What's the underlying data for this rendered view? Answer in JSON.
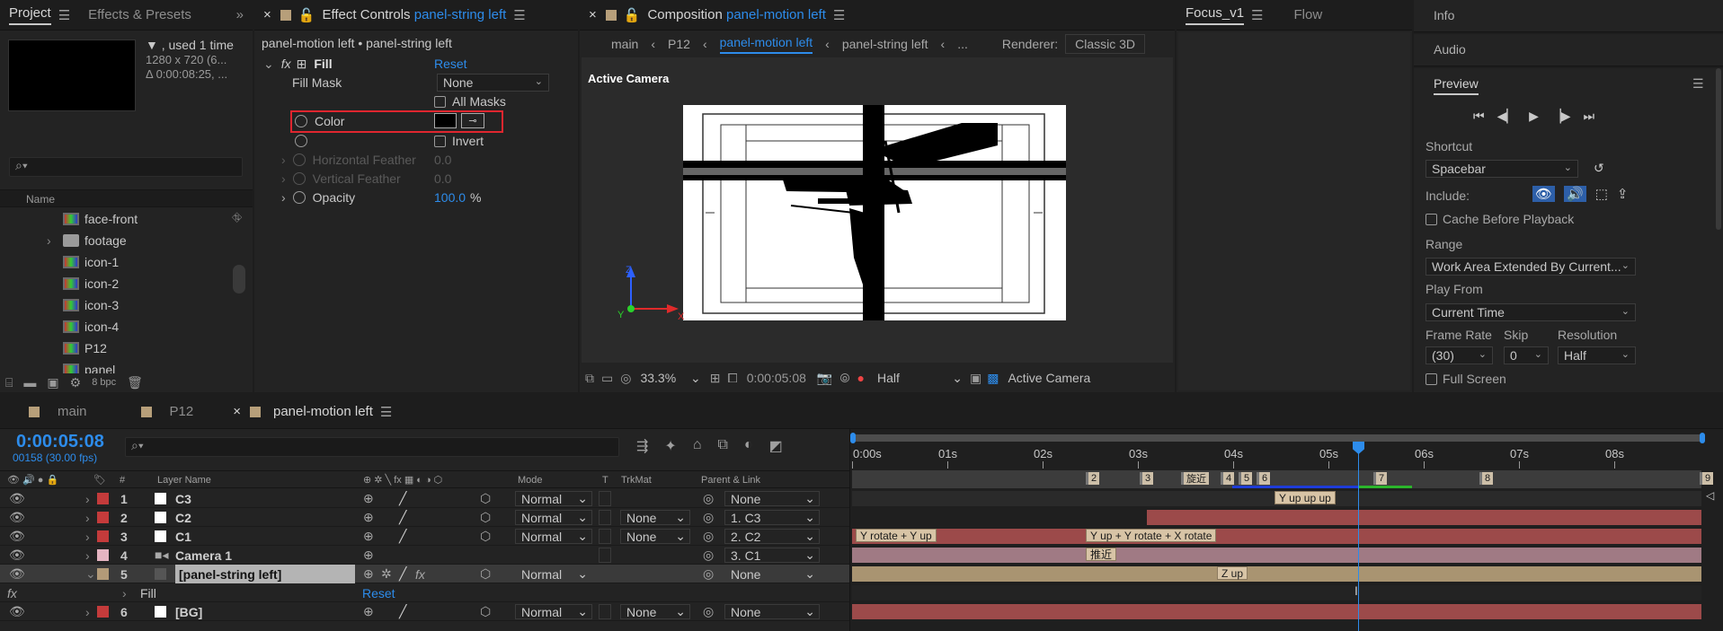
{
  "project": {
    "tab_project": "Project",
    "tab_effects": "Effects & Presets",
    "overflow": "»",
    "used": "▼ , used 1 time",
    "dims": "1280 x 720  (6...",
    "duration": "Δ 0:00:08:25, ...",
    "search_placeholder": "",
    "col_name": "Name",
    "items": [
      "face-front",
      "footage",
      "icon-1",
      "icon-2",
      "icon-3",
      "icon-4",
      "P12",
      "panel"
    ],
    "bpc": "8 bpc"
  },
  "effect_controls": {
    "title": "Effect Controls",
    "layer": "panel-string left",
    "breadcrumb": "panel-motion left • panel-string left",
    "fx_label": "fx",
    "effect_name": "Fill",
    "reset": "Reset",
    "fill_mask_label": "Fill Mask",
    "fill_mask_value": "None",
    "all_masks": "All Masks",
    "color_label": "Color",
    "invert": "Invert",
    "h_feather": "Horizontal Feather",
    "h_feather_val": "0.0",
    "v_feather": "Vertical Feather",
    "v_feather_val": "0.0",
    "opacity": "Opacity",
    "opacity_val": "100.0",
    "opacity_unit": "%"
  },
  "composition": {
    "title": "Composition",
    "name": "panel-motion left",
    "crumbs": [
      "main",
      "P12",
      "panel-motion left",
      "panel-string left",
      "..."
    ],
    "renderer_label": "Renderer:",
    "renderer_value": "Classic 3D",
    "active_camera_label": "Active Camera",
    "zoom": "33.3%",
    "timecode": "0:00:05:08",
    "resolution": "Half",
    "view": "Active Camera",
    "axis_z": "Z",
    "axis_y": "Y",
    "axis_x": "X"
  },
  "focus": {
    "tab1": "Focus_v1",
    "tab2": "Flow"
  },
  "right": {
    "info": "Info",
    "audio": "Audio",
    "preview": "Preview",
    "shortcut_label": "Shortcut",
    "shortcut_value": "Spacebar",
    "include_label": "Include:",
    "cache": "Cache Before Playback",
    "range_label": "Range",
    "range_value": "Work Area Extended By Current...",
    "playfrom_label": "Play From",
    "playfrom_value": "Current Time",
    "fr_label": "Frame Rate",
    "skip_label": "Skip",
    "res_label": "Resolution",
    "fr_value": "(30)",
    "skip_value": "0",
    "res_value": "Half",
    "fullscreen": "Full Screen"
  },
  "timeline": {
    "tabs": [
      "main",
      "P12",
      "panel-motion left"
    ],
    "timecode": "0:00:05:08",
    "frame_info": "00158 (30.00 fps)",
    "col_layer_name": "Layer Name",
    "col_mode": "Mode",
    "col_t": "T",
    "col_trkmat": "TrkMat",
    "col_parent": "Parent & Link",
    "ruler": [
      "0:00s",
      "01s",
      "02s",
      "03s",
      "04s",
      "05s",
      "06s",
      "07s",
      "08s"
    ],
    "layers": [
      {
        "num": "1",
        "name": "C3",
        "mode": "Normal",
        "trk": "",
        "parent": "None",
        "color": "#c43b3b"
      },
      {
        "num": "2",
        "name": "C2",
        "mode": "Normal",
        "trk": "None",
        "parent": "1. C3",
        "color": "#c43b3b"
      },
      {
        "num": "3",
        "name": "C1",
        "mode": "Normal",
        "trk": "None",
        "parent": "2. C2",
        "color": "#c43b3b"
      },
      {
        "num": "4",
        "name": "Camera 1",
        "mode": "",
        "trk": "",
        "parent": "3. C1",
        "color": "#e6b5c2"
      },
      {
        "num": "5",
        "name": "[panel-string left]",
        "mode": "Normal",
        "trk": "",
        "parent": "None",
        "color": "#b29a78"
      },
      {
        "num": "6",
        "name": "[BG]",
        "mode": "Normal",
        "trk": "None",
        "parent": "None",
        "color": "#c43b3b"
      }
    ],
    "fill_label": "Fill",
    "fill_reset": "Reset",
    "markers": [
      "2",
      "3",
      "旋近",
      "4",
      "5",
      "6",
      "7",
      "8",
      "9"
    ],
    "kf_labels": [
      "Y up up up",
      "Y rotate + Y up",
      "Y up + Y rotate + X rotate",
      "推近",
      "Z up"
    ]
  },
  "colors": {
    "accent": "#2d8ceb",
    "label_red": "#c43b3b",
    "label_pink": "#e6b5c2",
    "label_tan": "#b29a78"
  }
}
